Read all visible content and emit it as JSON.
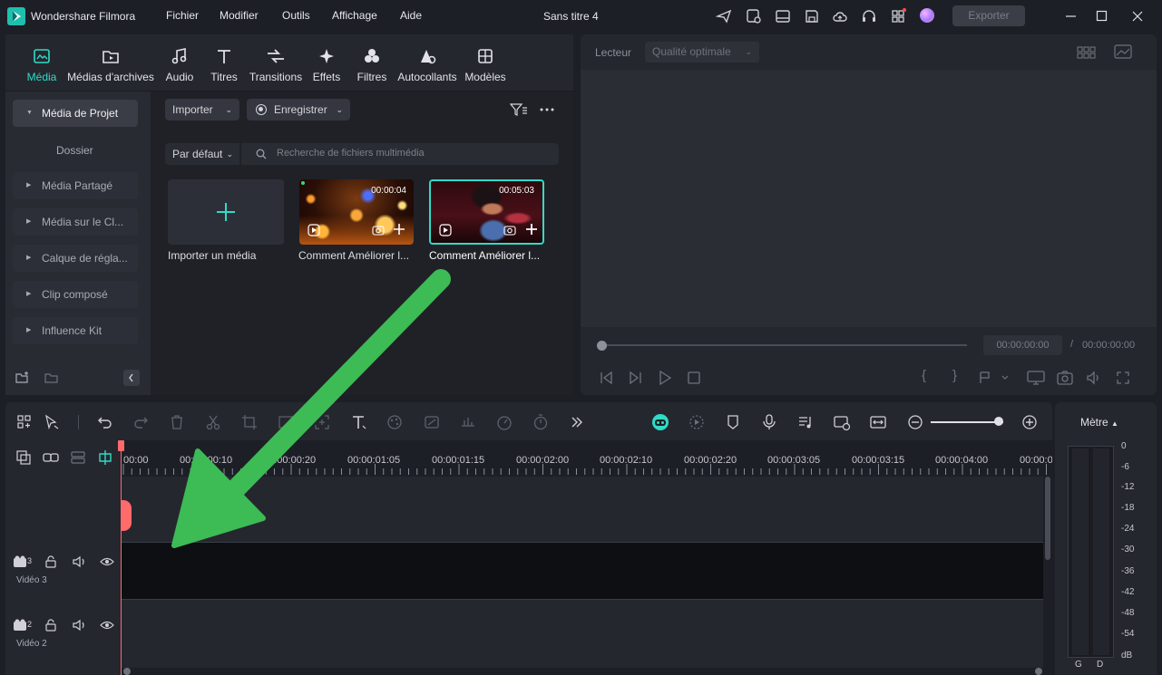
{
  "titlebar": {
    "app_name": "Wondershare Filmora",
    "menu": [
      "Fichier",
      "Modifier",
      "Outils",
      "Affichage",
      "Aide"
    ],
    "doc_title": "Sans titre 4",
    "export_label": "Exporter"
  },
  "media_panel": {
    "tabs": [
      {
        "label": "Média",
        "icon": "media-icon",
        "active": true
      },
      {
        "label": "Médias d'archives",
        "icon": "stock-media-icon"
      },
      {
        "label": "Audio",
        "icon": "music-note-icon"
      },
      {
        "label": "Titres",
        "icon": "text-t-icon"
      },
      {
        "label": "Transitions",
        "icon": "transition-arrows-icon"
      },
      {
        "label": "Effets",
        "icon": "sparkle-icon"
      },
      {
        "label": "Filtres",
        "icon": "filter-circles-icon"
      },
      {
        "label": "Autocollants",
        "icon": "sticker-icon"
      },
      {
        "label": "Modèles",
        "icon": "template-grid-icon"
      }
    ],
    "sidebar": {
      "project_media": "Média de Projet",
      "folder": "Dossier",
      "items": [
        "Média Partagé",
        "Média sur le Cl...",
        "Calque de régla...",
        "Clip composé",
        "Influence Kit"
      ]
    },
    "import_label": "Importer",
    "record_label": "Enregistrer",
    "sort_label": "Par défaut",
    "search_placeholder": "Recherche de fichiers multimédia",
    "import_tile_label": "Importer un média",
    "clips": [
      {
        "caption": "Comment Améliorer l...",
        "duration": "00:00:04"
      },
      {
        "caption": "Comment Améliorer l...",
        "duration": "00:05:03",
        "selected": true
      }
    ]
  },
  "player": {
    "label": "Lecteur",
    "quality": "Qualité optimale",
    "current_time": "00:00:00:00",
    "separator": "/",
    "total_time": "00:00:00:00"
  },
  "timeline": {
    "ruler": [
      "00:00",
      "00:00:00:10",
      "00:00:00:20",
      "00:00:01:05",
      "00:00:01:15",
      "00:00:02:00",
      "00:00:02:10",
      "00:00:02:20",
      "00:00:03:05",
      "00:00:03:15",
      "00:00:04:00",
      "00:00:0"
    ],
    "tracks": [
      {
        "index": "3",
        "name": "Vidéo 3"
      },
      {
        "index": "2",
        "name": "Vidéo 2"
      }
    ],
    "zoom_level": 0.85
  },
  "meter": {
    "title": "Mètre",
    "scale": [
      "0",
      "-6",
      "-12",
      "-18",
      "-24",
      "-30",
      "-36",
      "-42",
      "-48",
      "-54",
      "dB"
    ],
    "channels": [
      "G",
      "D"
    ]
  },
  "colors": {
    "accent": "#2fdcc6",
    "arrow": "#3dbb55",
    "playhead": "#ff5a5a"
  }
}
